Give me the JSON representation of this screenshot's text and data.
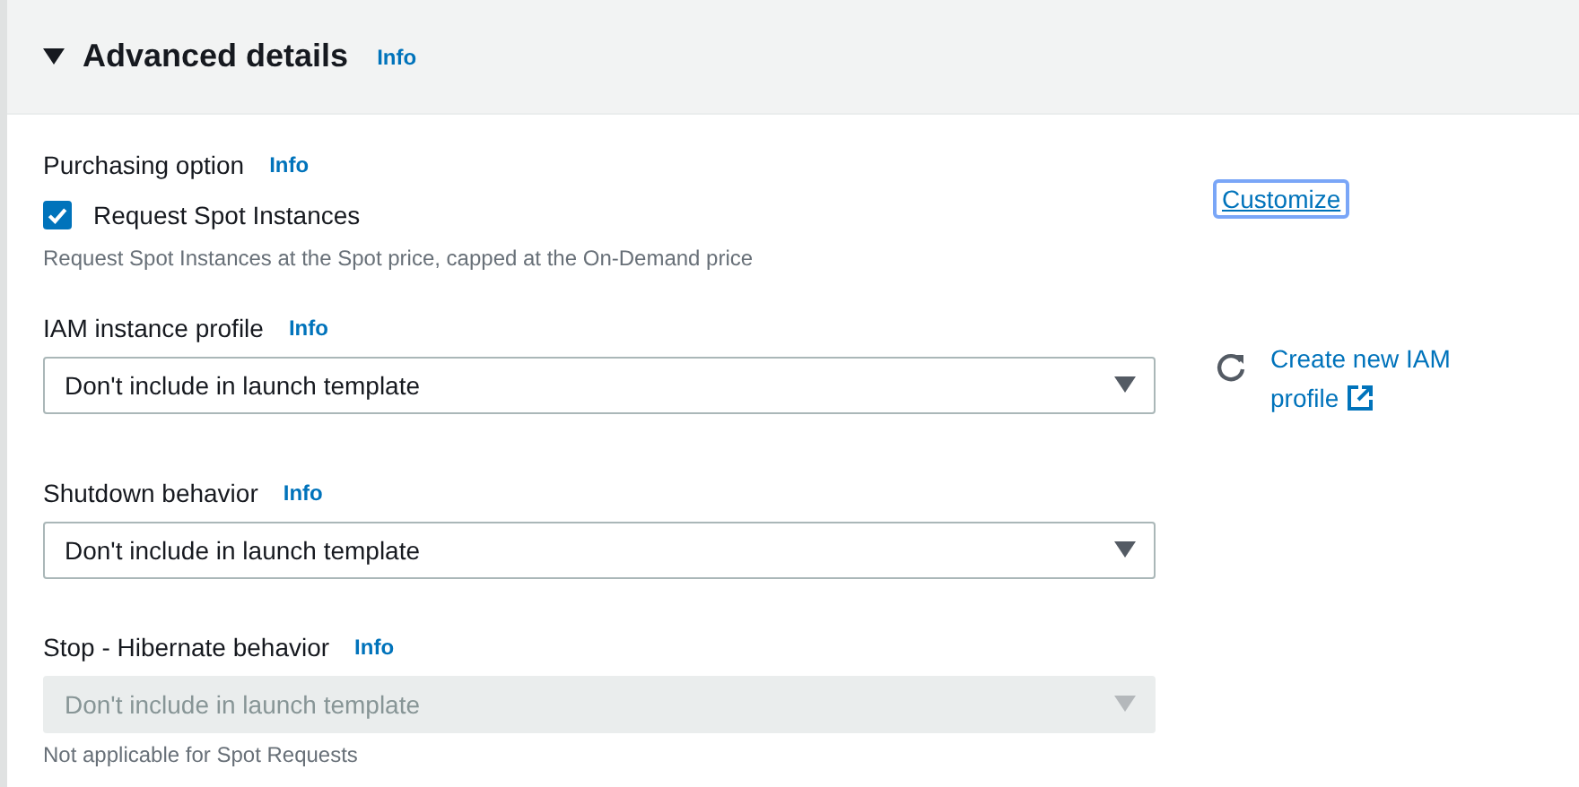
{
  "section": {
    "title": "Advanced details",
    "expanded": true,
    "info": "Info"
  },
  "fields": [
    {
      "kind": "checkbox",
      "label": "Purchasing option",
      "info": "Info",
      "option": "Request Spot Instances",
      "checked": true,
      "description": "Request Spot Instances at the Spot price, capped at the On-Demand price",
      "action": {
        "label": "Customize",
        "focused": true
      }
    },
    {
      "kind": "select",
      "label": "IAM instance profile",
      "info": "Info",
      "value": "Don't include in launch template",
      "disabled": false,
      "link": {
        "label": "Create new IAM profile"
      }
    },
    {
      "kind": "select",
      "label": "Shutdown behavior",
      "info": "Info",
      "value": "Don't include in launch template",
      "disabled": false
    },
    {
      "kind": "select",
      "label": "Stop - Hibernate behavior",
      "info": "Info",
      "value": "Don't include in launch template",
      "disabled": true,
      "description": "Not applicable for Spot Requests"
    }
  ]
}
